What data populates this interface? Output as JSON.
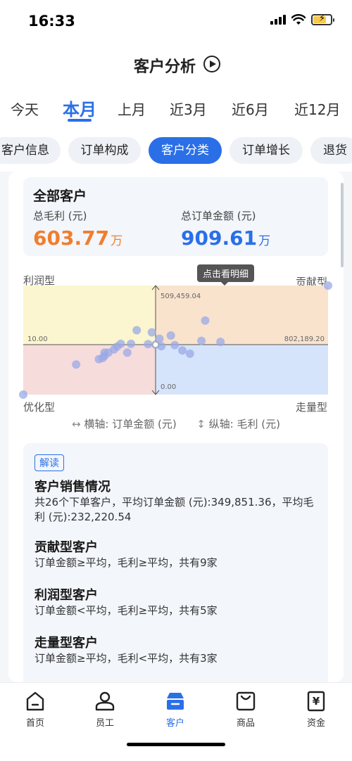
{
  "status_bar": {
    "time": "16:33"
  },
  "header": {
    "title": "客户分析"
  },
  "period_tabs": [
    {
      "label": "今天"
    },
    {
      "label": "本月",
      "active": true
    },
    {
      "label": "上月"
    },
    {
      "label": "近3月"
    },
    {
      "label": "近6月"
    },
    {
      "label": "近12月"
    }
  ],
  "chips": [
    {
      "label": "客户信息"
    },
    {
      "label": "订单构成"
    },
    {
      "label": "客户分类",
      "active": true
    },
    {
      "label": "订单增长"
    },
    {
      "label": "退货"
    }
  ],
  "summary": {
    "title": "全部客户",
    "gross_profit_label": "总毛利 (元)",
    "gross_profit_value": "603.77",
    "gross_profit_unit": "万",
    "order_amount_label": "总订单金额 (元)",
    "order_amount_value": "909.61",
    "order_amount_unit": "万"
  },
  "chart": {
    "tooltip": "点击看明细",
    "quadrants": {
      "top_left": "利润型",
      "top_right": "贡献型",
      "bottom_left": "优化型",
      "bottom_right": "走量型"
    },
    "axis_legend_x": "横轴: 订单金额 (元)",
    "axis_legend_y": "纵轴: 毛利 (元)",
    "colors": {
      "top_left": "#fbf6cf",
      "top_right": "#f9e3cd",
      "bottom_left": "#f7dcdc",
      "bottom_right": "#d6e4fb",
      "dot": "#9aa9e6"
    }
  },
  "chart_data": {
    "type": "scatter",
    "title": "",
    "xlabel": "订单金额 (元)",
    "ylabel": "毛利 (元)",
    "x_tick_min": "10.00",
    "x_tick_max": "802,189.20",
    "y_tick_min": "0.00",
    "y_tick_max": "509,459.04",
    "xlim": [
      10,
      802189.2
    ],
    "ylim": [
      0,
      509459.04
    ],
    "quadrant_center": {
      "x": 349851.36,
      "y": 232220.54
    },
    "points": [
      {
        "x": 349851,
        "y": 232220
      },
      {
        "x": 300000,
        "y": 300000
      },
      {
        "x": 340000,
        "y": 290000
      },
      {
        "x": 360000,
        "y": 260000
      },
      {
        "x": 390000,
        "y": 275000
      },
      {
        "x": 480000,
        "y": 345000
      },
      {
        "x": 400000,
        "y": 230000
      },
      {
        "x": 420000,
        "y": 205000
      },
      {
        "x": 440000,
        "y": 190000
      },
      {
        "x": 470000,
        "y": 250000
      },
      {
        "x": 520000,
        "y": 245000
      },
      {
        "x": 365000,
        "y": 225000
      },
      {
        "x": 285000,
        "y": 236000
      },
      {
        "x": 258000,
        "y": 236000
      },
      {
        "x": 248000,
        "y": 223000
      },
      {
        "x": 240000,
        "y": 210000
      },
      {
        "x": 225000,
        "y": 195000
      },
      {
        "x": 215000,
        "y": 180000
      },
      {
        "x": 200000,
        "y": 165000
      },
      {
        "x": 275000,
        "y": 195000
      },
      {
        "x": 215000,
        "y": 195000
      },
      {
        "x": 210000,
        "y": 170000
      },
      {
        "x": 140000,
        "y": 140000
      },
      {
        "x": 330000,
        "y": 235000
      },
      {
        "x": 10,
        "y": 0
      },
      {
        "x": 802189.2,
        "y": 509459.04
      }
    ]
  },
  "interpretation": {
    "badge": "解读",
    "sections": [
      {
        "title": "客户销售情况",
        "text": "共26个下单客户，平均订单金额 (元):349,851.36，平均毛利 (元):232,220.54"
      },
      {
        "title": "贡献型客户",
        "text": "订单金额≥平均，毛利≥平均，共有9家"
      },
      {
        "title": "利润型客户",
        "text": "订单金额<平均，毛利≥平均，共有5家"
      },
      {
        "title": "走量型客户",
        "text": "订单金额≥平均，毛利<平均，共有3家"
      }
    ]
  },
  "bottom_nav": [
    {
      "label": "首页",
      "icon": "home-icon"
    },
    {
      "label": "员工",
      "icon": "person-icon"
    },
    {
      "label": "客户",
      "icon": "customer-icon",
      "active": true
    },
    {
      "label": "商品",
      "icon": "shopping-bag-icon"
    },
    {
      "label": "资金",
      "icon": "yen-icon"
    }
  ]
}
